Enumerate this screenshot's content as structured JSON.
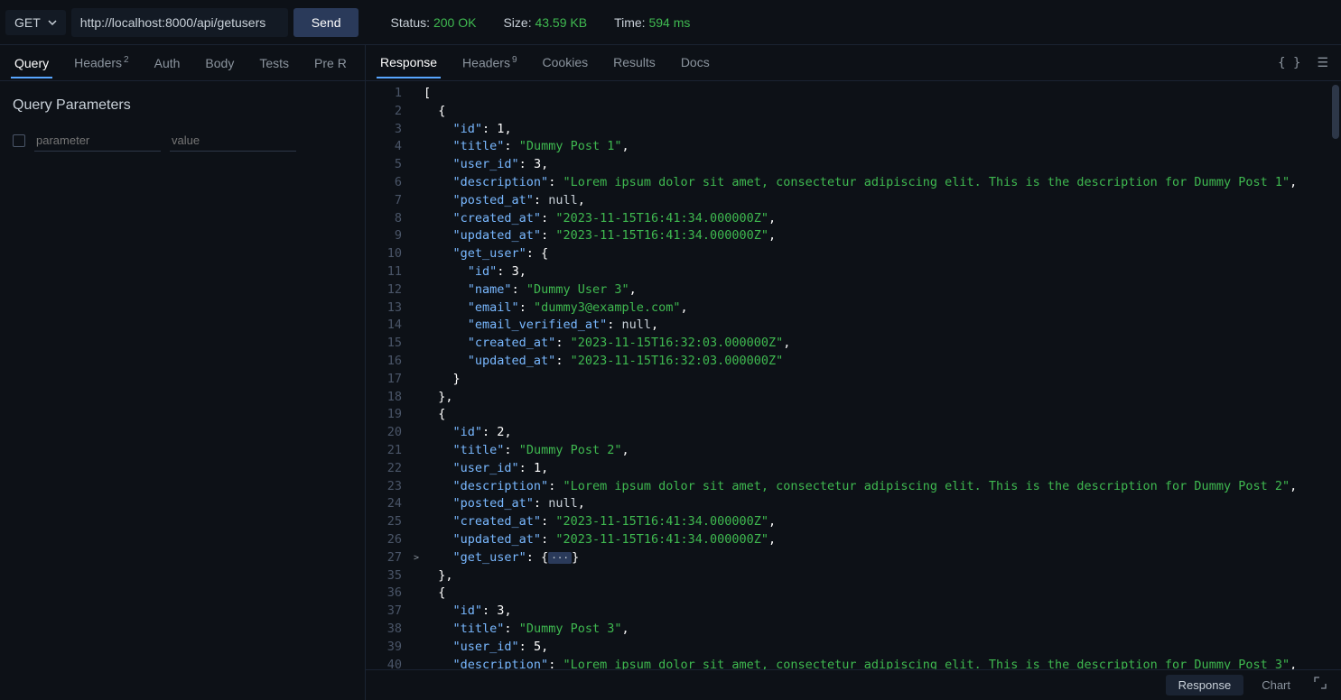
{
  "request": {
    "method": "GET",
    "url": "http://localhost:8000/api/getusers",
    "send_label": "Send"
  },
  "status_bar": {
    "status_label": "Status:",
    "status_value": "200 OK",
    "size_label": "Size:",
    "size_value": "43.59 KB",
    "time_label": "Time:",
    "time_value": "594 ms"
  },
  "left_tabs": [
    {
      "label": "Query",
      "active": true,
      "badge": ""
    },
    {
      "label": "Headers",
      "active": false,
      "badge": "2"
    },
    {
      "label": "Auth",
      "active": false,
      "badge": ""
    },
    {
      "label": "Body",
      "active": false,
      "badge": ""
    },
    {
      "label": "Tests",
      "active": false,
      "badge": ""
    },
    {
      "label": "Pre R",
      "active": false,
      "badge": ""
    }
  ],
  "query_section": {
    "title": "Query Parameters",
    "param_placeholder": "parameter",
    "value_placeholder": "value"
  },
  "right_tabs": [
    {
      "label": "Response",
      "active": true,
      "badge": ""
    },
    {
      "label": "Headers",
      "active": false,
      "badge": "9"
    },
    {
      "label": "Cookies",
      "active": false,
      "badge": ""
    },
    {
      "label": "Results",
      "active": false,
      "badge": ""
    },
    {
      "label": "Docs",
      "active": false,
      "badge": ""
    }
  ],
  "icons": {
    "brackets": "{ }",
    "menu": "☰"
  },
  "bottom": {
    "response": "Response",
    "chart": "Chart"
  },
  "code": {
    "line_numbers": [
      "1",
      "2",
      "3",
      "4",
      "5",
      "6",
      "7",
      "8",
      "9",
      "10",
      "11",
      "12",
      "13",
      "14",
      "15",
      "16",
      "17",
      "18",
      "19",
      "20",
      "21",
      "22",
      "23",
      "24",
      "25",
      "26",
      "27",
      "35",
      "36",
      "37",
      "38",
      "39",
      "40"
    ],
    "fold": {
      "27": ">"
    },
    "lines": [
      [
        {
          "t": "[",
          "c": "punc"
        }
      ],
      [
        {
          "t": "  {",
          "c": "punc"
        }
      ],
      [
        {
          "t": "    ",
          "c": ""
        },
        {
          "t": "\"id\"",
          "c": "key"
        },
        {
          "t": ": ",
          "c": "punc"
        },
        {
          "t": "1",
          "c": "num"
        },
        {
          "t": ",",
          "c": "punc"
        }
      ],
      [
        {
          "t": "    ",
          "c": ""
        },
        {
          "t": "\"title\"",
          "c": "key"
        },
        {
          "t": ": ",
          "c": "punc"
        },
        {
          "t": "\"Dummy Post 1\"",
          "c": "str"
        },
        {
          "t": ",",
          "c": "punc"
        }
      ],
      [
        {
          "t": "    ",
          "c": ""
        },
        {
          "t": "\"user_id\"",
          "c": "key"
        },
        {
          "t": ": ",
          "c": "punc"
        },
        {
          "t": "3",
          "c": "num"
        },
        {
          "t": ",",
          "c": "punc"
        }
      ],
      [
        {
          "t": "    ",
          "c": ""
        },
        {
          "t": "\"description\"",
          "c": "key"
        },
        {
          "t": ": ",
          "c": "punc"
        },
        {
          "t": "\"Lorem ipsum dolor sit amet, consectetur adipiscing elit. This is the description for Dummy Post 1\"",
          "c": "str"
        },
        {
          "t": ",",
          "c": "punc"
        }
      ],
      [
        {
          "t": "    ",
          "c": ""
        },
        {
          "t": "\"posted_at\"",
          "c": "key"
        },
        {
          "t": ": ",
          "c": "punc"
        },
        {
          "t": "null",
          "c": "null"
        },
        {
          "t": ",",
          "c": "punc"
        }
      ],
      [
        {
          "t": "    ",
          "c": ""
        },
        {
          "t": "\"created_at\"",
          "c": "key"
        },
        {
          "t": ": ",
          "c": "punc"
        },
        {
          "t": "\"2023-11-15T16:41:34.000000Z\"",
          "c": "str"
        },
        {
          "t": ",",
          "c": "punc"
        }
      ],
      [
        {
          "t": "    ",
          "c": ""
        },
        {
          "t": "\"updated_at\"",
          "c": "key"
        },
        {
          "t": ": ",
          "c": "punc"
        },
        {
          "t": "\"2023-11-15T16:41:34.000000Z\"",
          "c": "str"
        },
        {
          "t": ",",
          "c": "punc"
        }
      ],
      [
        {
          "t": "    ",
          "c": ""
        },
        {
          "t": "\"get_user\"",
          "c": "key"
        },
        {
          "t": ": {",
          "c": "punc"
        }
      ],
      [
        {
          "t": "      ",
          "c": ""
        },
        {
          "t": "\"id\"",
          "c": "key"
        },
        {
          "t": ": ",
          "c": "punc"
        },
        {
          "t": "3",
          "c": "num"
        },
        {
          "t": ",",
          "c": "punc"
        }
      ],
      [
        {
          "t": "      ",
          "c": ""
        },
        {
          "t": "\"name\"",
          "c": "key"
        },
        {
          "t": ": ",
          "c": "punc"
        },
        {
          "t": "\"Dummy User 3\"",
          "c": "str"
        },
        {
          "t": ",",
          "c": "punc"
        }
      ],
      [
        {
          "t": "      ",
          "c": ""
        },
        {
          "t": "\"email\"",
          "c": "key"
        },
        {
          "t": ": ",
          "c": "punc"
        },
        {
          "t": "\"dummy3@example.com\"",
          "c": "str"
        },
        {
          "t": ",",
          "c": "punc"
        }
      ],
      [
        {
          "t": "      ",
          "c": ""
        },
        {
          "t": "\"email_verified_at\"",
          "c": "key"
        },
        {
          "t": ": ",
          "c": "punc"
        },
        {
          "t": "null",
          "c": "null"
        },
        {
          "t": ",",
          "c": "punc"
        }
      ],
      [
        {
          "t": "      ",
          "c": ""
        },
        {
          "t": "\"created_at\"",
          "c": "key"
        },
        {
          "t": ": ",
          "c": "punc"
        },
        {
          "t": "\"2023-11-15T16:32:03.000000Z\"",
          "c": "str"
        },
        {
          "t": ",",
          "c": "punc"
        }
      ],
      [
        {
          "t": "      ",
          "c": ""
        },
        {
          "t": "\"updated_at\"",
          "c": "key"
        },
        {
          "t": ": ",
          "c": "punc"
        },
        {
          "t": "\"2023-11-15T16:32:03.000000Z\"",
          "c": "str"
        }
      ],
      [
        {
          "t": "    }",
          "c": "punc"
        }
      ],
      [
        {
          "t": "  },",
          "c": "punc"
        }
      ],
      [
        {
          "t": "  {",
          "c": "punc"
        }
      ],
      [
        {
          "t": "    ",
          "c": ""
        },
        {
          "t": "\"id\"",
          "c": "key"
        },
        {
          "t": ": ",
          "c": "punc"
        },
        {
          "t": "2",
          "c": "num"
        },
        {
          "t": ",",
          "c": "punc"
        }
      ],
      [
        {
          "t": "    ",
          "c": ""
        },
        {
          "t": "\"title\"",
          "c": "key"
        },
        {
          "t": ": ",
          "c": "punc"
        },
        {
          "t": "\"Dummy Post 2\"",
          "c": "str"
        },
        {
          "t": ",",
          "c": "punc"
        }
      ],
      [
        {
          "t": "    ",
          "c": ""
        },
        {
          "t": "\"user_id\"",
          "c": "key"
        },
        {
          "t": ": ",
          "c": "punc"
        },
        {
          "t": "1",
          "c": "num"
        },
        {
          "t": ",",
          "c": "punc"
        }
      ],
      [
        {
          "t": "    ",
          "c": ""
        },
        {
          "t": "\"description\"",
          "c": "key"
        },
        {
          "t": ": ",
          "c": "punc"
        },
        {
          "t": "\"Lorem ipsum dolor sit amet, consectetur adipiscing elit. This is the description for Dummy Post 2\"",
          "c": "str"
        },
        {
          "t": ",",
          "c": "punc"
        }
      ],
      [
        {
          "t": "    ",
          "c": ""
        },
        {
          "t": "\"posted_at\"",
          "c": "key"
        },
        {
          "t": ": ",
          "c": "punc"
        },
        {
          "t": "null",
          "c": "null"
        },
        {
          "t": ",",
          "c": "punc"
        }
      ],
      [
        {
          "t": "    ",
          "c": ""
        },
        {
          "t": "\"created_at\"",
          "c": "key"
        },
        {
          "t": ": ",
          "c": "punc"
        },
        {
          "t": "\"2023-11-15T16:41:34.000000Z\"",
          "c": "str"
        },
        {
          "t": ",",
          "c": "punc"
        }
      ],
      [
        {
          "t": "    ",
          "c": ""
        },
        {
          "t": "\"updated_at\"",
          "c": "key"
        },
        {
          "t": ": ",
          "c": "punc"
        },
        {
          "t": "\"2023-11-15T16:41:34.000000Z\"",
          "c": "str"
        },
        {
          "t": ",",
          "c": "punc"
        }
      ],
      [
        {
          "t": "    ",
          "c": ""
        },
        {
          "t": "\"get_user\"",
          "c": "key"
        },
        {
          "t": ": {",
          "c": "punc"
        },
        {
          "t": "···",
          "c": "ellipsis"
        },
        {
          "t": "}",
          "c": "punc"
        }
      ],
      [
        {
          "t": "  },",
          "c": "punc"
        }
      ],
      [
        {
          "t": "  {",
          "c": "punc"
        }
      ],
      [
        {
          "t": "    ",
          "c": ""
        },
        {
          "t": "\"id\"",
          "c": "key"
        },
        {
          "t": ": ",
          "c": "punc"
        },
        {
          "t": "3",
          "c": "num"
        },
        {
          "t": ",",
          "c": "punc"
        }
      ],
      [
        {
          "t": "    ",
          "c": ""
        },
        {
          "t": "\"title\"",
          "c": "key"
        },
        {
          "t": ": ",
          "c": "punc"
        },
        {
          "t": "\"Dummy Post 3\"",
          "c": "str"
        },
        {
          "t": ",",
          "c": "punc"
        }
      ],
      [
        {
          "t": "    ",
          "c": ""
        },
        {
          "t": "\"user_id\"",
          "c": "key"
        },
        {
          "t": ": ",
          "c": "punc"
        },
        {
          "t": "5",
          "c": "num"
        },
        {
          "t": ",",
          "c": "punc"
        }
      ],
      [
        {
          "t": "    ",
          "c": ""
        },
        {
          "t": "\"description\"",
          "c": "key"
        },
        {
          "t": ": ",
          "c": "punc"
        },
        {
          "t": "\"Lorem ipsum dolor sit amet, consectetur adipiscing elit. This is the description for Dummy Post 3\"",
          "c": "str"
        },
        {
          "t": ",",
          "c": "punc"
        }
      ]
    ]
  }
}
